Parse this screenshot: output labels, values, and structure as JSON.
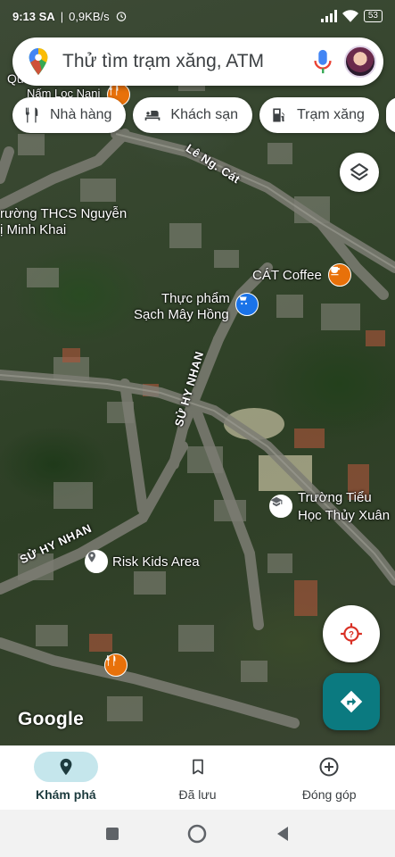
{
  "status_bar": {
    "time": "9:13 SA",
    "net_speed": "0,9KB/s",
    "battery": "53"
  },
  "search": {
    "placeholder": "Thử tìm trạm xăng, ATM"
  },
  "chips": [
    {
      "label": "Nhà hàng",
      "icon": "restaurant-icon"
    },
    {
      "label": "Khách sạn",
      "icon": "hotel-icon"
    },
    {
      "label": "Trạm xăng",
      "icon": "gas-station-icon"
    }
  ],
  "map": {
    "labels": {
      "nam_loc": "Nấm Loc Nani",
      "qu": "Qu",
      "thcs_1": "rường THCS Nguyễn",
      "thcs_2": "ị Minh Khai",
      "cat_coffee": "CÁT Coffee",
      "thuc_pham_1": "Thực phẩm",
      "thuc_pham_2": "Sạch Mây Hồng",
      "truong_1": "Trường Tiểu",
      "truong_2": "Học Thủy Xuân",
      "risk_kids": "Risk Kids Area"
    },
    "streets": {
      "le_ngo_cat": "Lê Ng. Cát",
      "su_hy_nhan_v": "SỬ HY NHAN",
      "su_hy_nhan_d": "SỬ HY NHAN"
    },
    "attribution": "Google"
  },
  "bottom_nav": [
    {
      "label": "Khám phá",
      "icon": "explore-pin-icon",
      "active": true
    },
    {
      "label": "Đã lưu",
      "icon": "bookmark-icon",
      "active": false
    },
    {
      "label": "Đóng góp",
      "icon": "add-circle-icon",
      "active": false
    }
  ],
  "colors": {
    "accent": "#0b7a80",
    "active_nav_bg": "#c5e6ec",
    "poi_food": "#e8710a",
    "poi_shop": "#1a73e8",
    "poi_school": "#5f6368"
  }
}
